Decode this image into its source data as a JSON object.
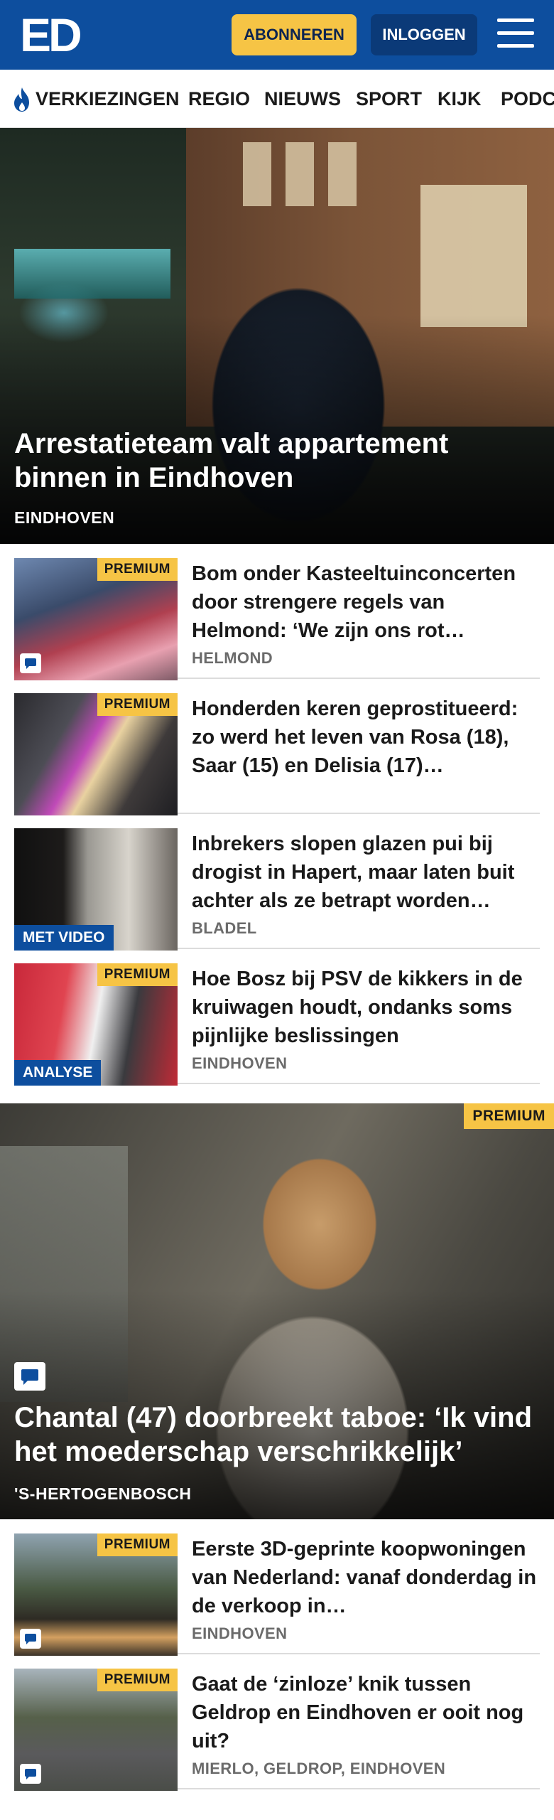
{
  "header": {
    "logo_text": "ED",
    "subscribe_label": "ABONNEREN",
    "login_label": "INLOGGEN",
    "menu_icon": "hamburger-menu-icon",
    "brand_color": "#0d4e9e",
    "accent_color": "#f6c445"
  },
  "nav": {
    "items": [
      {
        "label": "VERKIEZINGEN",
        "icon": "flame-icon"
      },
      {
        "label": "REGIO"
      },
      {
        "label": "NIEUWS"
      },
      {
        "label": "SPORT"
      },
      {
        "label": "KIJK"
      },
      {
        "label": "PODC"
      }
    ]
  },
  "hero": {
    "title": "Arrestatieteam valt appartement binnen in Eindhoven",
    "location": "EINDHOVEN"
  },
  "articles": [
    {
      "badge": "PREMIUM",
      "title": "Bom onder Kasteeltuinconcerten door strengere regels van Helmond: ‘We zijn ons rot…",
      "location": "HELMOND",
      "comment_icon": "comment-icon"
    },
    {
      "badge": "PREMIUM",
      "title": "Honderden keren geprostitueerd: zo werd het leven van Rosa (18), Saar (15) en Delisia (17)…",
      "location": ""
    },
    {
      "label": "MET VIDEO",
      "title": "Inbrekers slopen glazen pui bij drogist in Hapert, maar laten buit achter als ze betrapt worden…",
      "location": "BLADEL"
    },
    {
      "badge": "PREMIUM",
      "label": "ANALYSE",
      "title": "Hoe Bosz bij PSV de kikkers in de kruiwagen houdt, ondanks soms pijnlijke beslissingen",
      "location": "EINDHOVEN"
    }
  ],
  "feature": {
    "badge": "PREMIUM",
    "title": "Chantal (47) doorbreekt taboe: ‘Ik vind het moederschap verschrikkelijk’",
    "location": "'S-HERTOGENBOSCH",
    "comment_icon": "comment-icon"
  },
  "articles_bottom": [
    {
      "badge": "PREMIUM",
      "title": "Eerste 3D-geprinte koopwonin­gen van Nederland: vanaf donderdag in de verkoop in…",
      "location": "EINDHOVEN",
      "comment_icon": "comment-icon"
    },
    {
      "badge": "PREMIUM",
      "title": "Gaat de ‘zinloze’ knik tussen Geldrop en Eindhoven er ooit nog uit?",
      "location": "MIERLO, GELDROP, EINDHOVEN",
      "comment_icon": "comment-icon"
    }
  ]
}
